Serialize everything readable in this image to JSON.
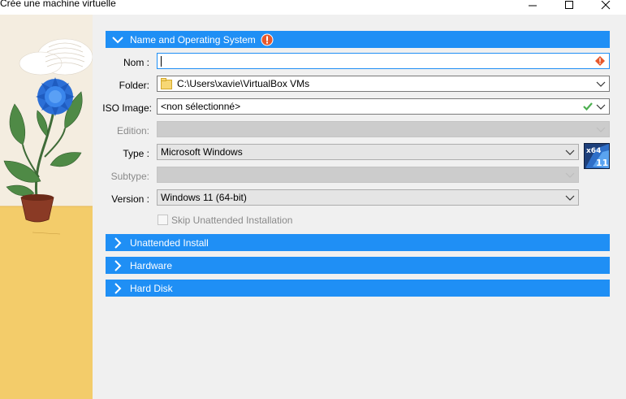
{
  "window": {
    "title": "Crée une machine virtuelle",
    "controls": [
      "minimize",
      "maximize",
      "close"
    ]
  },
  "sections": {
    "name_os": {
      "label": "Name and Operating System",
      "expanded": true,
      "warning": true
    },
    "unattended": {
      "label": "Unattended Install",
      "expanded": false
    },
    "hardware": {
      "label": "Hardware",
      "expanded": false
    },
    "hard_disk": {
      "label": "Hard Disk",
      "expanded": false
    }
  },
  "form": {
    "nom": {
      "label": "Nom :",
      "value": "",
      "has_error": true
    },
    "folder": {
      "label": "Folder:",
      "value": "C:\\Users\\xavie\\VirtualBox VMs",
      "icon": "folder-icon"
    },
    "iso": {
      "label": "ISO Image:",
      "value": "<non sélectionné>",
      "valid": true
    },
    "edition": {
      "label": "Edition:",
      "value": "",
      "disabled": true
    },
    "type": {
      "label": "Type :",
      "value": "Microsoft Windows"
    },
    "subtype": {
      "label": "Subtype:",
      "value": "",
      "disabled": true
    },
    "version": {
      "label": "Version :",
      "value": "Windows 11 (64-bit)"
    },
    "os_badge": {
      "top": "x64",
      "bottom": "11"
    },
    "skip_unattended": {
      "label": "Skip Unattended Installation",
      "checked": false,
      "disabled": true
    }
  },
  "colors": {
    "accent": "#1f8ff5",
    "warning": "#e8582b",
    "valid": "#4caf50"
  }
}
